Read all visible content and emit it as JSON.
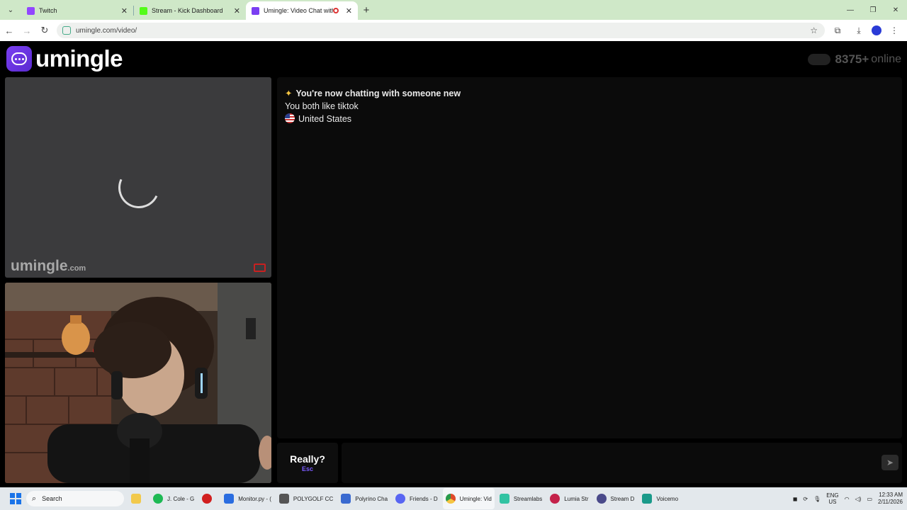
{
  "browser": {
    "tabs": [
      {
        "title": "Twitch",
        "favicon_color": "#9146ff",
        "active": false
      },
      {
        "title": "Stream - Kick Dashboard",
        "favicon_color": "#53fc18",
        "active": false
      },
      {
        "title": "Umingle: Video Chat with S",
        "favicon_color": "#7b3ff2",
        "active": true
      }
    ],
    "url": "umingle.com/video/"
  },
  "site": {
    "logo_text": "umingle",
    "online_count": "8375+",
    "online_label": "online",
    "accent_color": "#7b3ff2"
  },
  "remote_video": {
    "watermark": "umingle",
    "watermark_suffix": ".com",
    "state": "loading"
  },
  "chat": {
    "new_match": "You're now chatting with someone new",
    "common_interest": "You both like tiktok",
    "country": "United States"
  },
  "composer": {
    "skip_label": "Really?",
    "skip_hotkey": "Esc",
    "input_value": "",
    "send_icon": "send-icon"
  },
  "taskbar": {
    "search_label": "Search",
    "apps": [
      {
        "label": "J. Cole - G",
        "color": "#1db954"
      },
      {
        "label": "",
        "color": "#d11f1f"
      },
      {
        "label": "Monitor.py - (",
        "color": "#2a6de0"
      },
      {
        "label": "POLYGOLF CC",
        "color": "#555555"
      },
      {
        "label": "Polyrino Cha",
        "color": "#3a6ad0"
      },
      {
        "label": "Friends - D",
        "color": "#5865f2"
      },
      {
        "label": "Umingle: Vid",
        "color": "#e04a2a"
      },
      {
        "label": "Streamlabs",
        "color": "#31c3a2"
      },
      {
        "label": "Lumia Str",
        "color": "#c4224a"
      },
      {
        "label": "Stream D",
        "color": "#4a4a8a"
      },
      {
        "label": "Voicemo",
        "color": "#1a9a8a"
      }
    ],
    "lang_top": "ENG",
    "lang_bottom": "US",
    "time": "12:33 AM",
    "date": "2/11/2026"
  }
}
